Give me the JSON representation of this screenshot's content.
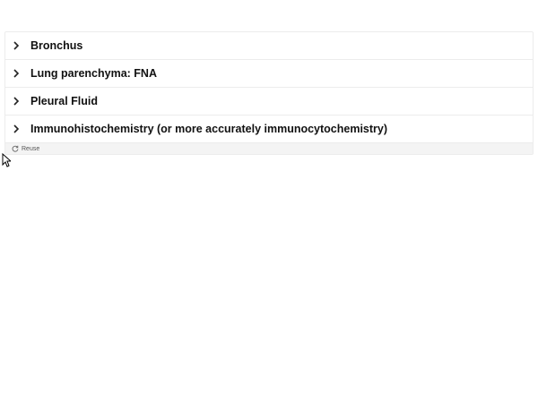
{
  "accordion": {
    "items": [
      {
        "label": "Bronchus"
      },
      {
        "label": "Lung parenchyma: FNA"
      },
      {
        "label": "Pleural Fluid"
      },
      {
        "label": "Immunohistochemistry (or more accurately immunocytochemistry)"
      }
    ]
  },
  "footer": {
    "reuse_label": "Reuse",
    "reuse_icon": "refresh-icon"
  },
  "icons": {
    "chevron": "chevron-right-icon",
    "cursor": "mouse-pointer-icon"
  },
  "colors": {
    "border": "#ececec",
    "footer_bg": "#f4f4f4",
    "text": "#111111"
  }
}
